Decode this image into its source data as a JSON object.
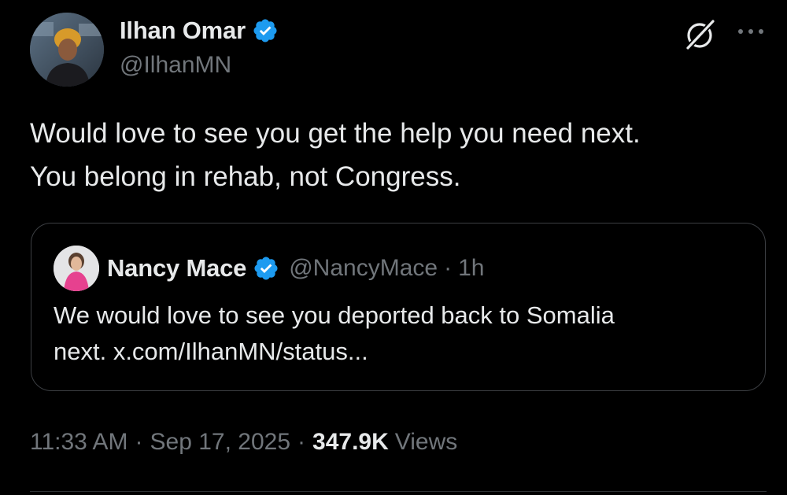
{
  "tweet": {
    "author": {
      "name": "Ilhan Omar",
      "handle": "@IlhanMN",
      "verified": true,
      "avatar_icon": "profile-photo"
    },
    "text_lines": [
      "Would love to see you get the help you need next.",
      "You belong in rehab, not Congress."
    ],
    "quote": {
      "author": {
        "name": "Nancy Mace",
        "handle": "@NancyMace",
        "verified": true,
        "avatar_icon": "profile-photo"
      },
      "separator": "·",
      "time": "1h",
      "text_lines": [
        "We would love to see you deported back to Somalia",
        "next. x.com/IlhanMN/status..."
      ]
    },
    "meta": {
      "time": "11:33 AM",
      "separator": "·",
      "date": "Sep 17, 2025",
      "views_count": "347.9K",
      "views_label": "Views"
    }
  },
  "icons": {
    "verified_badge": "verified-badge-icon",
    "grok": "grok-icon",
    "more": "more-options-icon"
  },
  "colors": {
    "background": "#000000",
    "primary_text": "#e7e9ea",
    "secondary_text": "#71767b",
    "verified_blue": "#1d9bf0",
    "border": "#3c3f43"
  }
}
